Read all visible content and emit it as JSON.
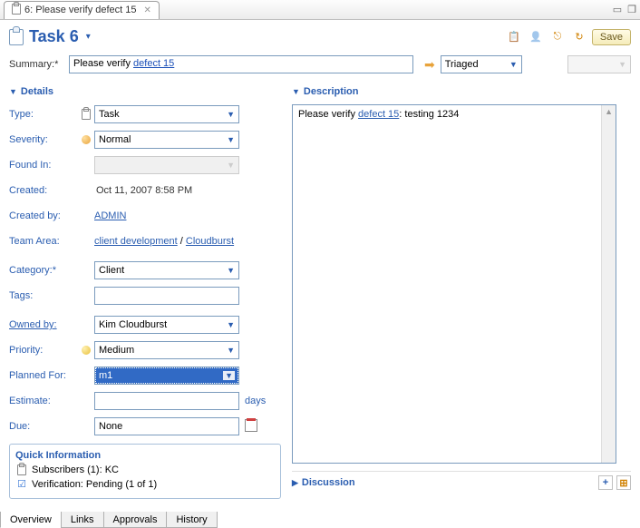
{
  "tab": {
    "title": "6: Please verify defect 15"
  },
  "header": {
    "title": "Task 6",
    "save_label": "Save"
  },
  "summary": {
    "label": "Summary:",
    "text_pre": "Please verify ",
    "link": "defect 15",
    "status": "Triaged"
  },
  "details": {
    "section": "Details",
    "type": {
      "label": "Type:",
      "value": "Task"
    },
    "severity": {
      "label": "Severity:",
      "value": "Normal"
    },
    "foundin": {
      "label": "Found In:",
      "value": ""
    },
    "created": {
      "label": "Created:",
      "value": "Oct 11, 2007 8:58 PM"
    },
    "createdby": {
      "label": "Created by:",
      "value": "ADMIN"
    },
    "teamarea": {
      "label": "Team Area:",
      "link1": "client development",
      "sep": " / ",
      "link2": "Cloudburst"
    },
    "category": {
      "label": "Category:",
      "value": "Client"
    },
    "tags": {
      "label": "Tags:",
      "value": ""
    },
    "ownedby": {
      "label": "Owned by:",
      "value": "Kim Cloudburst"
    },
    "priority": {
      "label": "Priority:",
      "value": "Medium"
    },
    "plannedfor": {
      "label": "Planned For:",
      "value": "m1"
    },
    "estimate": {
      "label": "Estimate:",
      "value": "",
      "suffix": "days"
    },
    "due": {
      "label": "Due:",
      "value": "None"
    }
  },
  "description": {
    "section": "Description",
    "text_pre": "Please verify ",
    "link": "defect 15",
    "text_post": ": testing 1234"
  },
  "quick": {
    "section": "Quick Information",
    "subscribers": "Subscribers (1): KC",
    "verification": "Verification: Pending (1 of 1)"
  },
  "discussion": {
    "section": "Discussion"
  },
  "tabs": {
    "overview": "Overview",
    "links": "Links",
    "approvals": "Approvals",
    "history": "History"
  }
}
